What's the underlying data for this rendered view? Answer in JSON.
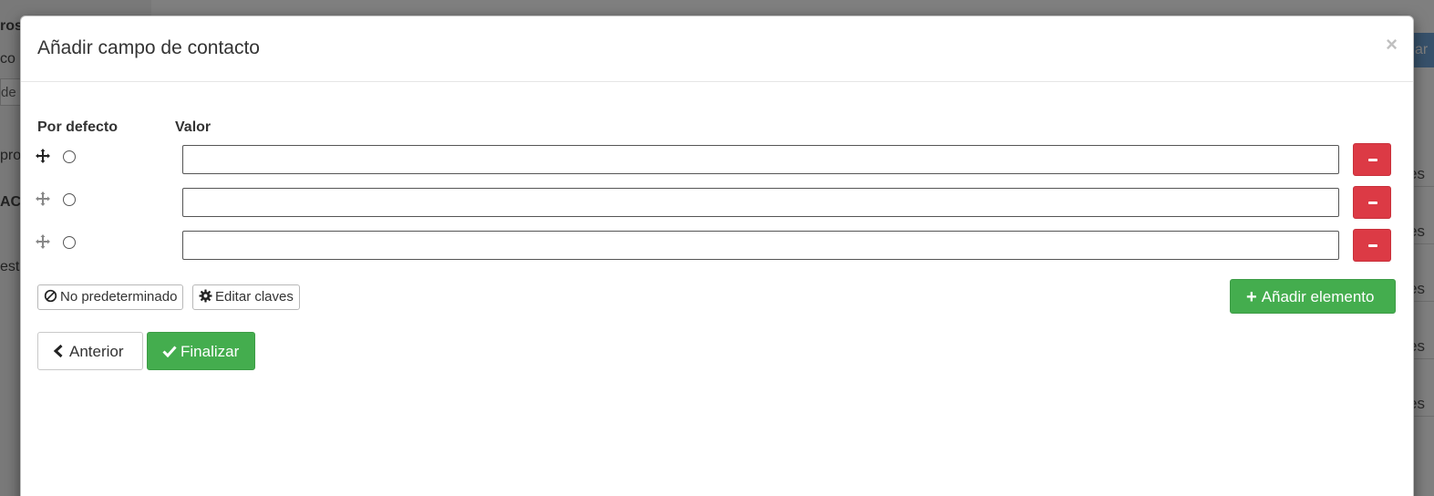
{
  "background": {
    "sidebar_fragments": [
      "ros",
      "co",
      "de c",
      "pro",
      "ACI",
      "est"
    ],
    "right_button_fragment": "ar",
    "right_row_fragments": [
      "es",
      "es",
      "es",
      "es",
      "es"
    ]
  },
  "modal": {
    "title": "Añadir campo de contacto",
    "close_symbol": "×",
    "columns": {
      "default_label": "Por defecto",
      "value_label": "Valor"
    },
    "rows": [
      {
        "value": "",
        "default_selected": false
      },
      {
        "value": "",
        "default_selected": false
      },
      {
        "value": "",
        "default_selected": false
      }
    ],
    "buttons": {
      "no_default_label": "No predeterminado",
      "edit_keys_label": "Editar claves",
      "add_element_label": "Añadir elemento",
      "previous_label": "Anterior",
      "finish_label": "Finalizar"
    },
    "colors": {
      "danger": "#dc3a45",
      "success": "#44ad4e"
    },
    "icons": {
      "move": "move-icon",
      "remove": "minus-icon",
      "no_default": "ban-icon",
      "edit_keys": "gear-icon",
      "add": "plus-icon",
      "previous": "chevron-left-icon",
      "finish": "check-icon",
      "close": "close-icon"
    }
  }
}
